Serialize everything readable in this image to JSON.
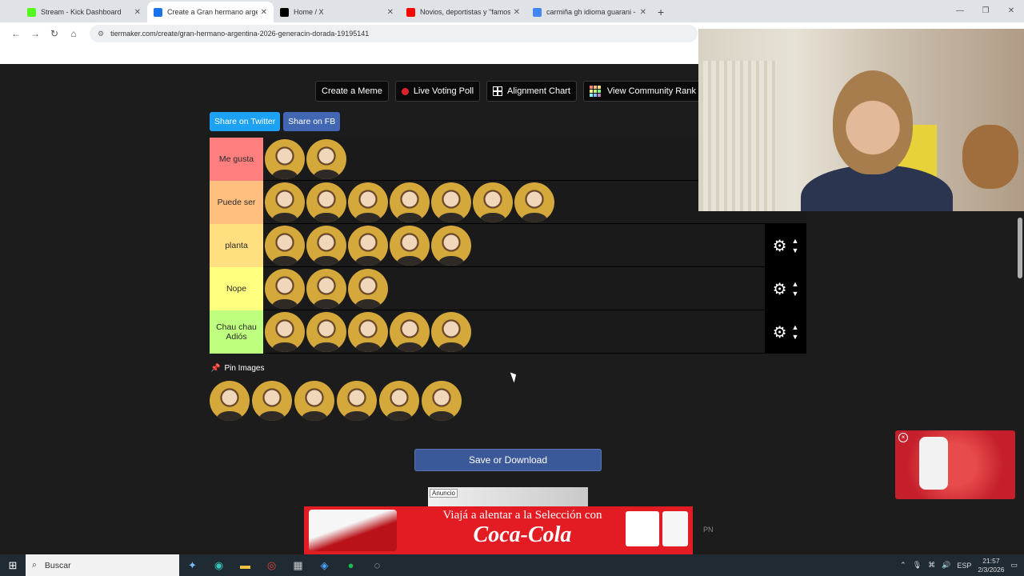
{
  "browser": {
    "tabs": [
      {
        "title": "Stream - Kick Dashboard",
        "color": "#53fc18",
        "active": false
      },
      {
        "title": "Create a Gran hermano argentin",
        "color": "#1a73e8",
        "active": true
      },
      {
        "title": "Home / X",
        "color": "#000000",
        "active": false
      },
      {
        "title": "Novios, deportistas y \"famosos\"",
        "color": "#ff0000",
        "active": false
      },
      {
        "title": "carmiña gh idioma guarani - Bu",
        "color": "#4285f4",
        "active": false
      }
    ],
    "new_tab": "+",
    "url": "tiermaker.com/create/gran-hermano-argentina-2026-generacin-dorada-19195141"
  },
  "toolbar": {
    "create_meme": "Create a Meme",
    "live_poll": "Live Voting Poll",
    "alignment_chart": "Alignment Chart",
    "community_rank": "View Community Rank"
  },
  "share": {
    "twitter": "Share on Twitter",
    "facebook": "Share on FB"
  },
  "tiers": [
    {
      "label": "Me gusta",
      "color": "#ff7f7f",
      "count": 2
    },
    {
      "label": "Puede ser",
      "color": "#ffbf7f",
      "count": 7
    },
    {
      "label": "planta",
      "color": "#ffdf7f",
      "count": 5
    },
    {
      "label": "Nope",
      "color": "#ffff7f",
      "count": 3
    },
    {
      "label": "Chau chau Adiós",
      "color": "#bfff7f",
      "count": 5
    }
  ],
  "pin_images": "Pin Images",
  "pool_count": 6,
  "save_button": "Save or Download",
  "ad": {
    "tag": "Anuncio",
    "headline": "Viajá a alentar a la Selección con",
    "brand": "Coca-Cola",
    "side_label": "PN"
  },
  "taskbar": {
    "search": "Buscar",
    "lang": "ESP",
    "time": "21:57",
    "date": "2/3/2026"
  }
}
